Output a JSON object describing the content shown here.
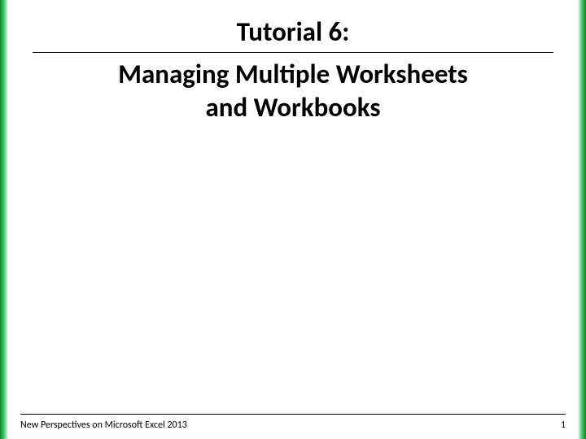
{
  "title": {
    "line1": "Tutorial 6:",
    "line2": "Managing Multiple Worksheets",
    "line3": "and Workbooks"
  },
  "footer": {
    "left": "New Perspectives on Microsoft Excel 2013",
    "page": "1"
  },
  "colors": {
    "accent": "#0a8a2e"
  }
}
